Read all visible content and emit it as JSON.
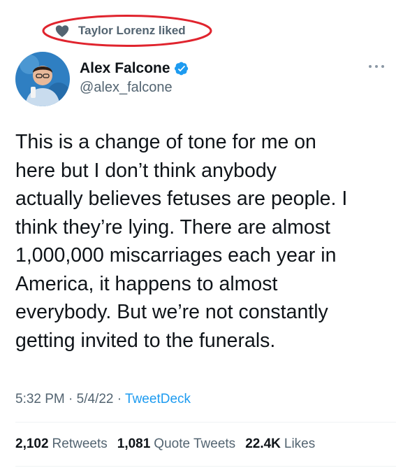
{
  "social_context": {
    "text": "Taylor Lorenz liked",
    "icon": "heart-icon",
    "highlight_color": "#e0242e"
  },
  "author": {
    "display_name": "Alex Falcone",
    "handle": "@alex_falcone",
    "verified": true,
    "verified_color": "#1d9bf0"
  },
  "tweet": {
    "text": "This is a change of tone for me on\nhere but I don’t think anybody\nactually believes fetuses are people. I\nthink they’re lying. There are almost\n1,000,000 miscarriages each year in\nAmerica, it happens to almost\neverybody. But we’re not constantly\ngetting invited to the funerals.",
    "time": "5:32 PM",
    "date": "5/4/22",
    "separator": "·",
    "source": "TweetDeck"
  },
  "stats": {
    "retweets_count": "2,102",
    "retweets_label": "Retweets",
    "quotes_count": "1,081",
    "quotes_label": "Quote Tweets",
    "likes_count": "22.4K",
    "likes_label": "Likes"
  }
}
